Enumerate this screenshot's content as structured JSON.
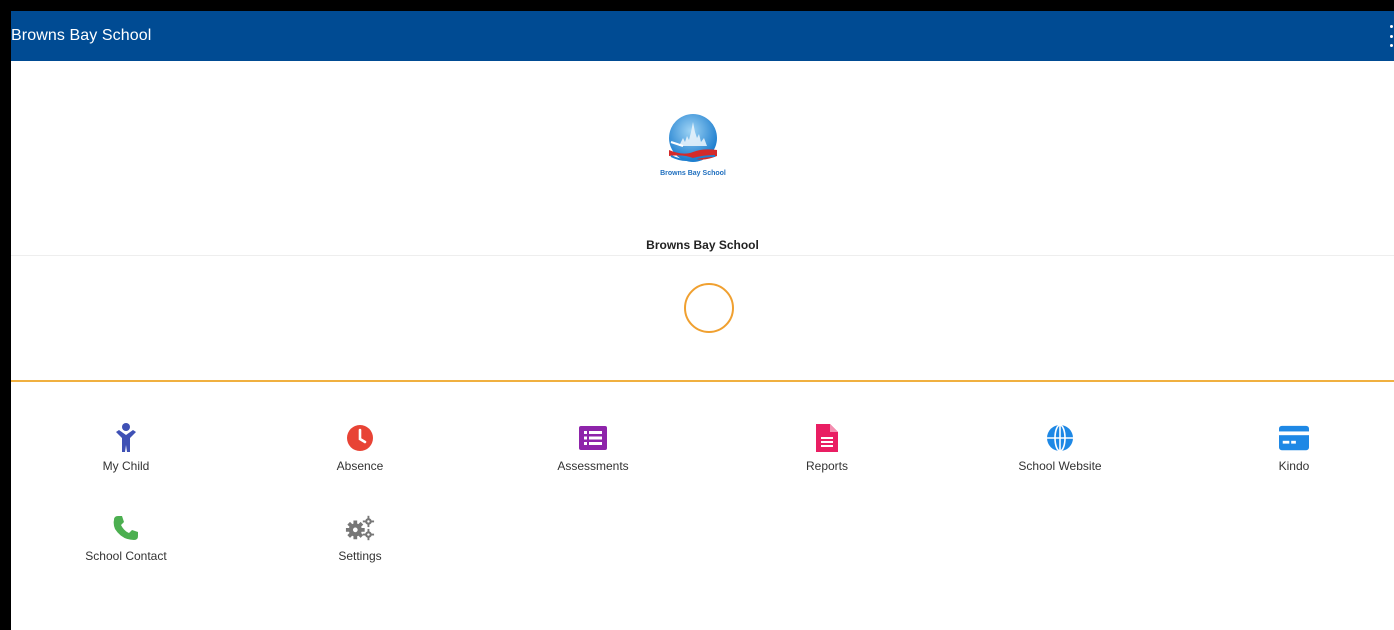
{
  "appbar": {
    "title": "Browns Bay School"
  },
  "school": {
    "logo_text": "Browns Bay School",
    "name": "Browns Bay School"
  },
  "tiles": [
    {
      "label": "My Child",
      "icon": "child-icon",
      "color": "#3f51b5"
    },
    {
      "label": "Absence",
      "icon": "clock-icon",
      "color": "#e84335"
    },
    {
      "label": "Assessments",
      "icon": "list-icon",
      "color": "#8e24aa"
    },
    {
      "label": "Reports",
      "icon": "document-icon",
      "color": "#e91e63"
    },
    {
      "label": "School Website",
      "icon": "globe-icon",
      "color": "#1e88e5"
    },
    {
      "label": "Kindo",
      "icon": "card-icon",
      "color": "#1e88e5"
    },
    {
      "label": "School Contact",
      "icon": "phone-icon",
      "color": "#4caf50"
    },
    {
      "label": "Settings",
      "icon": "gears-icon",
      "color": "#757575"
    }
  ],
  "colors": {
    "appbar": "#004b93",
    "accent": "#f0a030"
  }
}
